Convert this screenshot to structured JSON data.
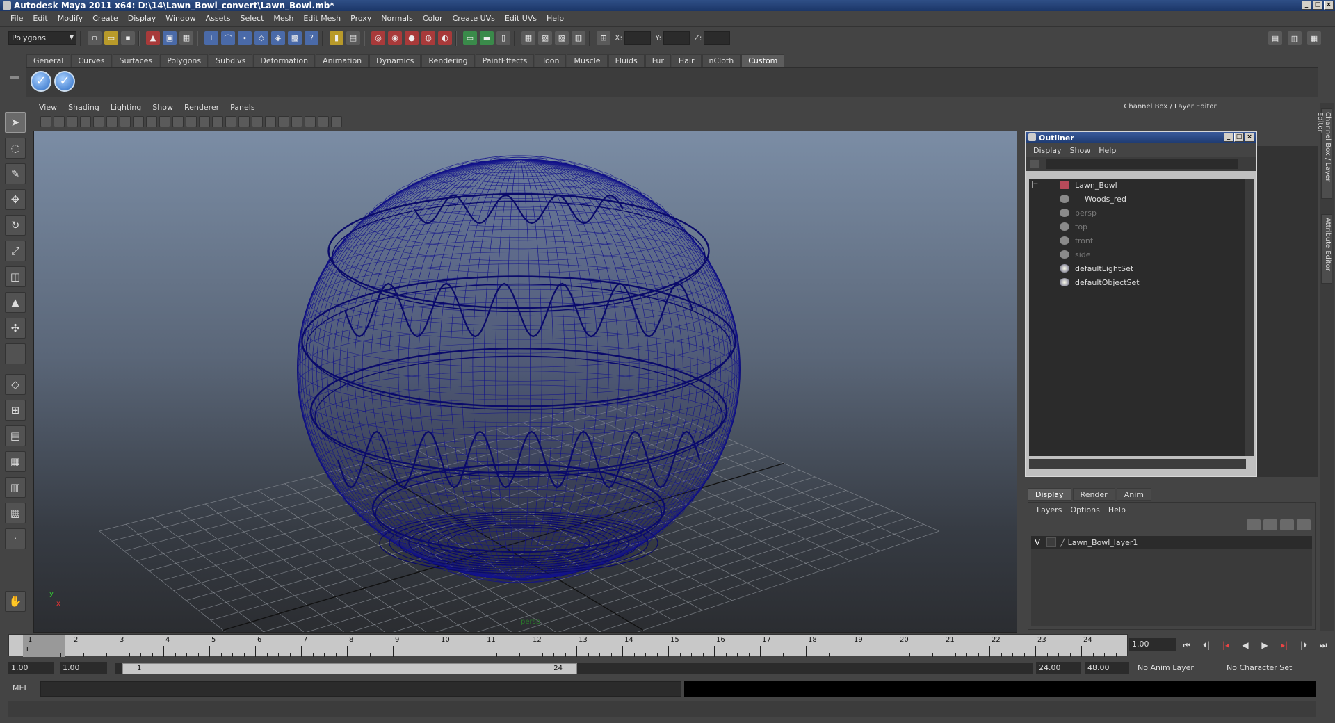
{
  "window": {
    "title": "Autodesk Maya 2011 x64: D:\\14\\Lawn_Bowl_convert\\Lawn_Bowl.mb*"
  },
  "menubar": [
    "File",
    "Edit",
    "Modify",
    "Create",
    "Display",
    "Window",
    "Assets",
    "Select",
    "Mesh",
    "Edit Mesh",
    "Proxy",
    "Normals",
    "Color",
    "Create UVs",
    "Edit UVs",
    "Help"
  ],
  "statusline": {
    "mode": "Polygons",
    "x_label": "X:",
    "y_label": "Y:",
    "z_label": "Z:"
  },
  "shelf_tabs": [
    "General",
    "Curves",
    "Surfaces",
    "Polygons",
    "Subdivs",
    "Deformation",
    "Animation",
    "Dynamics",
    "Rendering",
    "PaintEffects",
    "Toon",
    "Muscle",
    "Fluids",
    "Fur",
    "Hair",
    "nCloth",
    "Custom"
  ],
  "shelf_active": "Custom",
  "viewport_menu": [
    "View",
    "Shading",
    "Lighting",
    "Show",
    "Renderer",
    "Panels"
  ],
  "viewport": {
    "camera_label": "persp",
    "axis_y": "y",
    "axis_x": "x"
  },
  "channel_box_title": "Channel Box / Layer Editor",
  "side_tabs": [
    "Channel Box / Layer Editor",
    "Attribute Editor"
  ],
  "outliner": {
    "title": "Outliner",
    "menu": [
      "Display",
      "Show",
      "Help"
    ],
    "items": [
      {
        "label": "Lawn_Bowl",
        "dim": false,
        "icon": "mesh-transform-icon"
      },
      {
        "label": "Woods_red",
        "dim": false,
        "icon": "shape-icon"
      },
      {
        "label": "persp",
        "dim": true,
        "icon": "camera-icon"
      },
      {
        "label": "top",
        "dim": true,
        "icon": "camera-icon"
      },
      {
        "label": "front",
        "dim": true,
        "icon": "camera-icon"
      },
      {
        "label": "side",
        "dim": true,
        "icon": "camera-icon"
      },
      {
        "label": "defaultLightSet",
        "dim": false,
        "icon": "set-icon"
      },
      {
        "label": "defaultObjectSet",
        "dim": false,
        "icon": "set-icon"
      }
    ]
  },
  "layer_editor": {
    "tabs": [
      "Display",
      "Render",
      "Anim"
    ],
    "menu": [
      "Layers",
      "Options",
      "Help"
    ],
    "layer": {
      "visibility": "V",
      "name": "Lawn_Bowl_layer1"
    }
  },
  "timeslider": {
    "ticks": [
      "1",
      "2",
      "3",
      "4",
      "5",
      "6",
      "7",
      "8",
      "9",
      "10",
      "11",
      "12",
      "13",
      "14",
      "15",
      "16",
      "17",
      "18",
      "19",
      "20",
      "21",
      "22",
      "23",
      "24"
    ],
    "current_marker": "1",
    "current_frame": "1.00"
  },
  "range": {
    "start": "1.00",
    "playback_start": "1.00",
    "thumb_start": "1",
    "thumb_end": "24",
    "playback_end": "24.00",
    "end": "48.00",
    "anim_layer": "No Anim Layer",
    "character_set": "No Character Set"
  },
  "cmdline": {
    "label": "MEL"
  }
}
